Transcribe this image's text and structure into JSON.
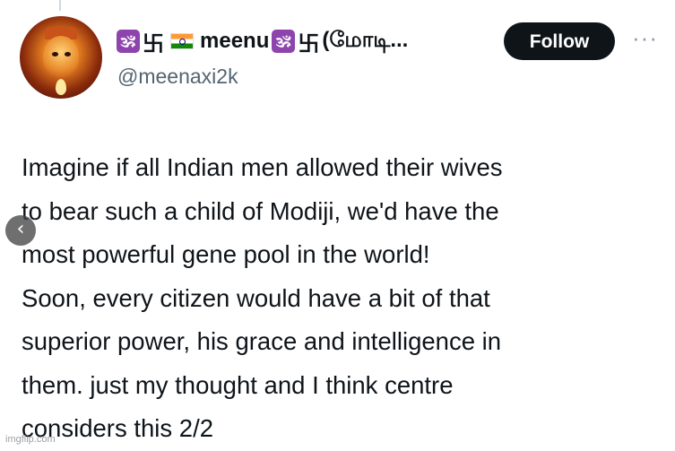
{
  "post": {
    "author": {
      "display_name_prefix": "🕉",
      "display_name_glyph": "卐",
      "display_name": "meenu",
      "display_name_suffix_om": "🕉",
      "display_name_suffix_glyph": "卐",
      "display_name_tail": "(மோடி...",
      "handle": "@meenaxi2k"
    },
    "follow_label": "Follow",
    "more_label": "···",
    "text_lines": [
      "Imagine if all Indian men allowed their wives",
      "to bear such a child of Modiji, we'd have the",
      "most powerful gene pool in the world!",
      "Soon, every citizen would have a bit of that",
      "superior power, his grace and intelligence in",
      "them. just my thought and I think centre",
      "considers this 2/2"
    ]
  },
  "overlay": {
    "prev_icon": "‹"
  },
  "watermark": "imgflip.com",
  "colors": {
    "text": "#0f1419",
    "secondary": "#536471",
    "button_bg": "#0f1419",
    "om_badge": "#8e44ad"
  }
}
